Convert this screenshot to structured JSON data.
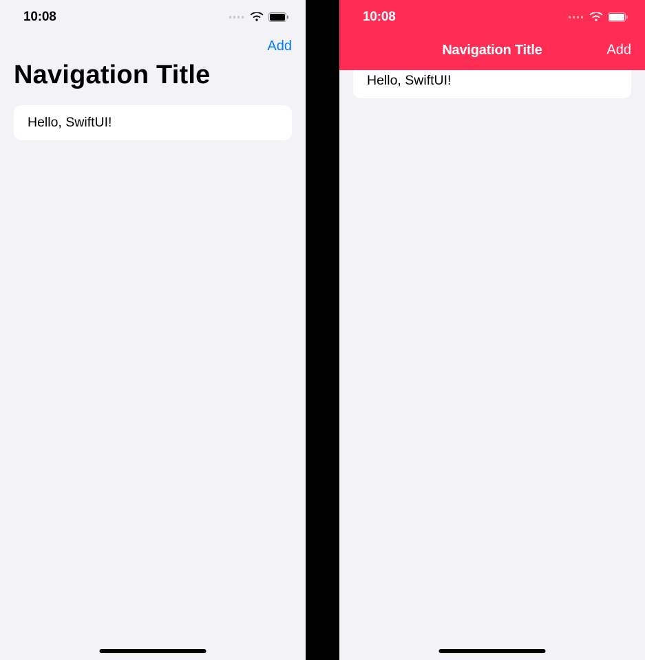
{
  "status": {
    "time": "10:08"
  },
  "left": {
    "nav": {
      "title": "Navigation Title",
      "add_label": "Add"
    },
    "row_text": "Hello, SwiftUI!",
    "accent_color": "#007aff"
  },
  "right": {
    "nav": {
      "title": "Navigation Title",
      "add_label": "Add",
      "bar_color": "#ff2d55"
    },
    "row_text": "Hello, SwiftUI!"
  }
}
